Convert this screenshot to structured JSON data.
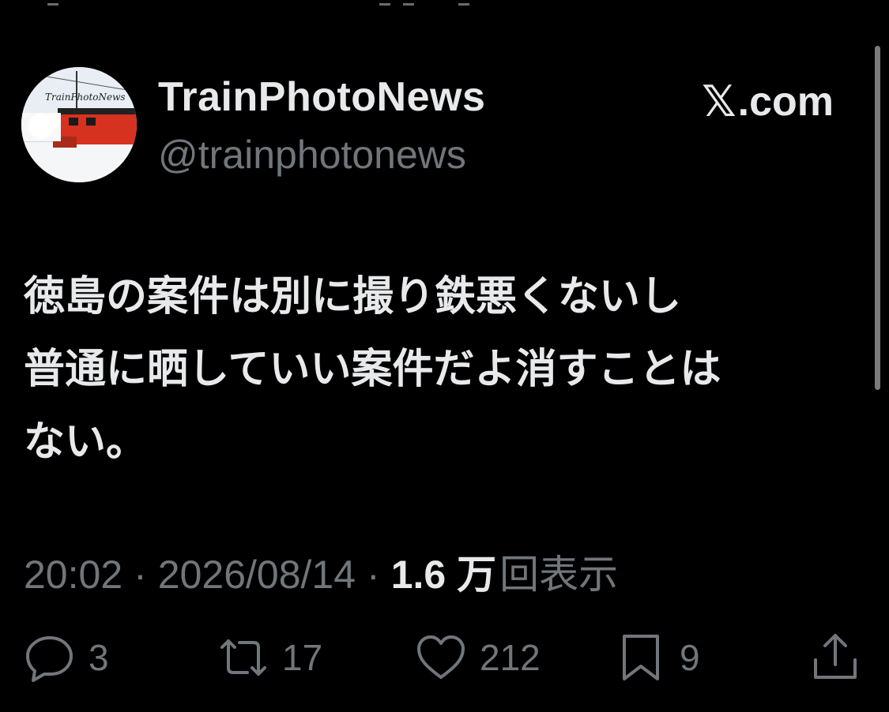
{
  "author": {
    "display_name": "TrainPhotoNews",
    "handle": "@trainphotonews",
    "avatar_logo_text": "TrainPhotoNews"
  },
  "source_label": ".com",
  "tweet": {
    "text": "徳島の案件は別に撮り鉄悪くないし\n普通に晒していい案件だよ消すことは\nない。"
  },
  "meta": {
    "time": "20:02",
    "date": "2026/08/14",
    "views_count": "1.6 万",
    "views_label": "回表示"
  },
  "actions": {
    "replies": "3",
    "reposts": "17",
    "likes": "212",
    "bookmarks": "9"
  },
  "colors": {
    "background": "#000000",
    "primary_text": "#e7e9ea",
    "secondary_text": "#71767b"
  }
}
